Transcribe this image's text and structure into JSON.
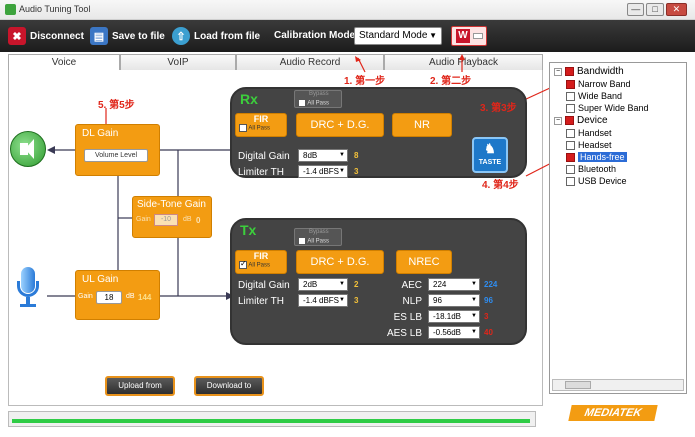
{
  "window": {
    "title": "Audio Tuning Tool",
    "controls": [
      "—",
      "□",
      "✕"
    ]
  },
  "toolbar": {
    "disconnect": "Disconnect",
    "save": "Save to file",
    "load": "Load from file",
    "cal_label": "Calibration Mode",
    "cal_value": "Standard Mode",
    "w_label": "W"
  },
  "tabs": [
    {
      "label": "Voice",
      "active": true
    },
    {
      "label": "VoIP"
    },
    {
      "label": "Audio Record"
    },
    {
      "label": "Audio Playback"
    }
  ],
  "annotations": {
    "step1": "1. 第一步",
    "step2": "2. 第二步",
    "step3": "3. 第3步",
    "step4": "4. 第4步",
    "step5": "5. 第5步"
  },
  "rx": {
    "title": "Rx",
    "bypass": "Bypass",
    "allpass_top": "All Pass",
    "fir": "FIR",
    "allpass": "All Pass",
    "drc": "DRC + D.G.",
    "nr": "NR",
    "dg_label": "Digital Gain",
    "dg_value": "8dB",
    "dg_num": "8",
    "lim_label": "Limiter TH",
    "lim_value": "-1.4 dBFS",
    "lim_num": "3",
    "taste": "TASTE"
  },
  "tx": {
    "title": "Tx",
    "bypass": "Bypass",
    "allpass_top": "All Pass",
    "fir": "FIR",
    "allpass": "All Pass",
    "drc": "DRC + D.G.",
    "nrec": "NREC",
    "dg_label": "Digital Gain",
    "dg_value": "2dB",
    "dg_num": "2",
    "lim_label": "Limiter TH",
    "lim_value": "-1.4 dBFS",
    "lim_num": "3",
    "params": [
      {
        "label": "AEC",
        "value": "224",
        "num": "224",
        "color": "#2f8df0"
      },
      {
        "label": "NLP",
        "value": "96",
        "num": "96",
        "color": "#2f8df0"
      },
      {
        "label": "ES LB",
        "value": "-18.1dB",
        "num": "3",
        "color": "#e0261a"
      },
      {
        "label": "AES LB",
        "value": "-0.56dB",
        "num": "40",
        "color": "#e0261a"
      }
    ]
  },
  "dl": {
    "title": "DL Gain",
    "volume": "Volume Level"
  },
  "sidetone": {
    "title": "Side-Tone Gain",
    "gain_label": "Gain",
    "gain_value": "-10",
    "unit": "dB",
    "num": "0"
  },
  "ul": {
    "title": "UL Gain",
    "gain_label": "Gain",
    "gain_value": "18",
    "unit": "dB",
    "num": "144"
  },
  "buttons": {
    "upload": "Upload from Device",
    "download": "Download to Device"
  },
  "tree": {
    "bandwidth": "Bandwidth",
    "narrow": "Narrow Band",
    "wide": "Wide Band",
    "swb": "Super Wide Band",
    "device": "Device",
    "handset": "Handset",
    "headset": "Headset",
    "handsfree": "Hands-free",
    "bluetooth": "Bluetooth",
    "usb": "USB Device"
  },
  "brand": "MEDIATEK"
}
